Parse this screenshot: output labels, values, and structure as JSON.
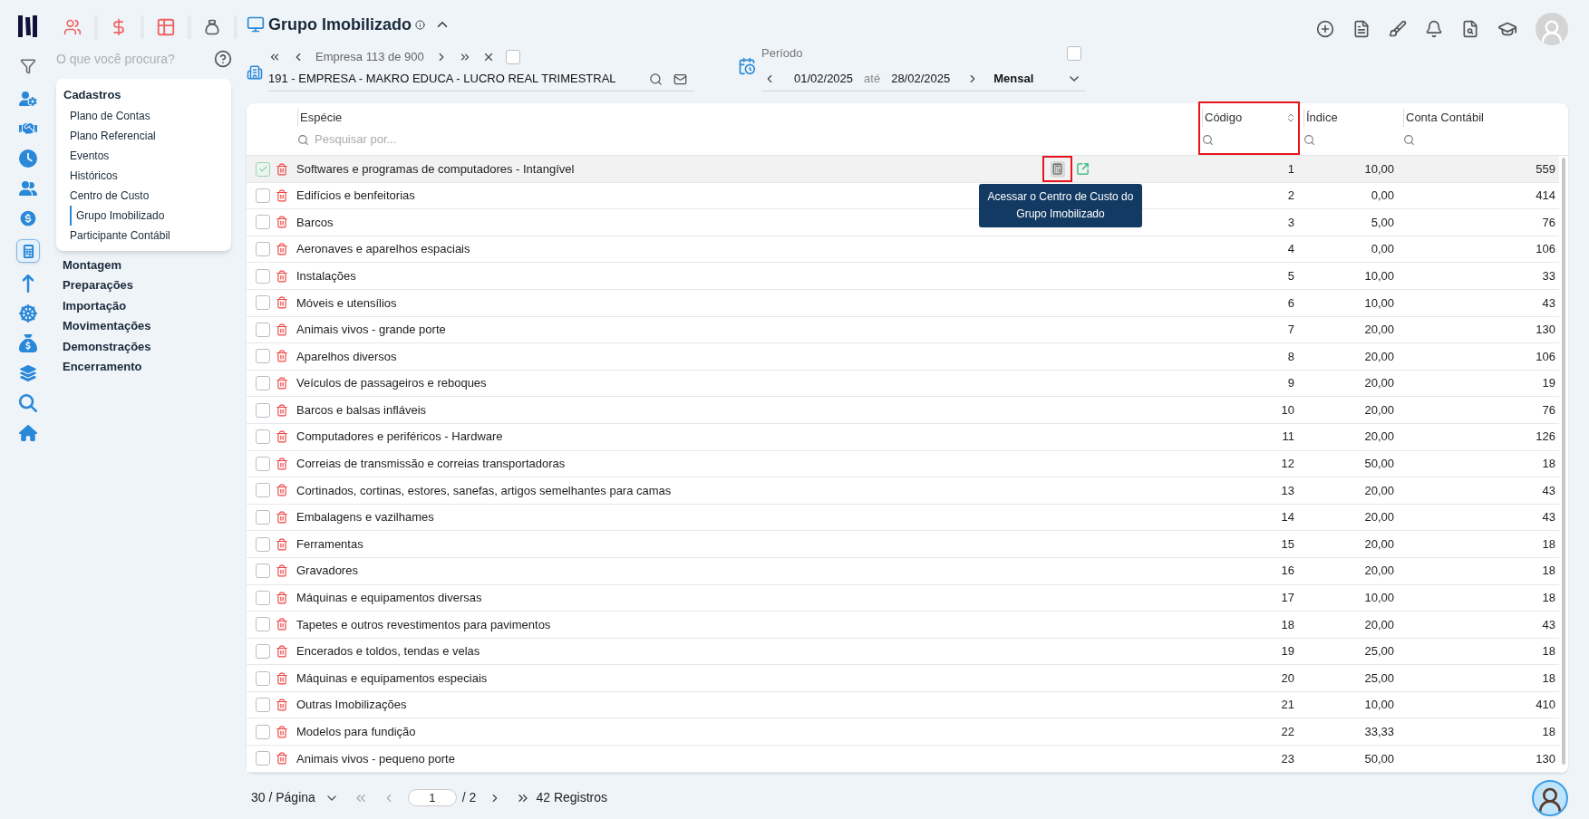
{
  "search": {
    "placeholder": "O que você procura?"
  },
  "menu": [
    {
      "label": "Cadastros",
      "expanded": true,
      "items": [
        {
          "label": "Plano de Contas",
          "selected": false
        },
        {
          "label": "Plano Referencial",
          "selected": false
        },
        {
          "label": "Eventos",
          "selected": false
        },
        {
          "label": "Históricos",
          "selected": false
        },
        {
          "label": "Centro de Custo",
          "selected": false
        },
        {
          "label": "Grupo Imobilizado",
          "selected": true
        },
        {
          "label": "Participante Contábil",
          "selected": false
        }
      ]
    },
    {
      "label": "Montagem",
      "expanded": false
    },
    {
      "label": "Preparações",
      "expanded": false
    },
    {
      "label": "Importação",
      "expanded": false
    },
    {
      "label": "Movimentações",
      "expanded": false
    },
    {
      "label": "Demonstrações",
      "expanded": false
    },
    {
      "label": "Encerramento",
      "expanded": false
    }
  ],
  "page": {
    "title": "Grupo Imobilizado"
  },
  "company_nav": {
    "counter": "Empresa 113 de 900",
    "company": "191 - EMPRESA - MAKRO EDUCA - LUCRO REAL TRIMESTRAL",
    "checked": false
  },
  "period": {
    "label": "Período",
    "start": "01/02/2025",
    "separator": "até",
    "end": "28/02/2025",
    "frequency": "Mensal",
    "checked": false
  },
  "table": {
    "columns": [
      {
        "label": "Espécie",
        "search_placeholder": "Pesquisar por...",
        "sorted": false,
        "highlighted": false
      },
      {
        "label": "Código",
        "sorted": true,
        "highlighted": true
      },
      {
        "label": "Índice",
        "sorted": false,
        "highlighted": false
      },
      {
        "label": "Conta Contábil",
        "sorted": false,
        "highlighted": false
      }
    ],
    "tooltip": "Acessar o Centro de Custo do Grupo Imobilizado",
    "rows": [
      {
        "especie": "Softwares e programas de computadores - Intangível",
        "codigo": "1",
        "indice": "10,00",
        "conta": "559",
        "selected": true,
        "hovered": true
      },
      {
        "especie": "Edifícios e benfeitorias",
        "codigo": "2",
        "indice": "0,00",
        "conta": "414",
        "selected": false,
        "hovered": false
      },
      {
        "especie": "Barcos",
        "codigo": "3",
        "indice": "5,00",
        "conta": "76",
        "selected": false,
        "hovered": false
      },
      {
        "especie": "Aeronaves e aparelhos espaciais",
        "codigo": "4",
        "indice": "0,00",
        "conta": "106",
        "selected": false,
        "hovered": false
      },
      {
        "especie": "Instalações",
        "codigo": "5",
        "indice": "10,00",
        "conta": "33",
        "selected": false,
        "hovered": false
      },
      {
        "especie": "Móveis e utensílios",
        "codigo": "6",
        "indice": "10,00",
        "conta": "43",
        "selected": false,
        "hovered": false
      },
      {
        "especie": "Animais vivos - grande porte",
        "codigo": "7",
        "indice": "20,00",
        "conta": "130",
        "selected": false,
        "hovered": false
      },
      {
        "especie": "Aparelhos diversos",
        "codigo": "8",
        "indice": "20,00",
        "conta": "106",
        "selected": false,
        "hovered": false
      },
      {
        "especie": "Veículos de passageiros e reboques",
        "codigo": "9",
        "indice": "20,00",
        "conta": "19",
        "selected": false,
        "hovered": false
      },
      {
        "especie": "Barcos e balsas infláveis",
        "codigo": "10",
        "indice": "20,00",
        "conta": "76",
        "selected": false,
        "hovered": false
      },
      {
        "especie": "Computadores e periféricos - Hardware",
        "codigo": "11",
        "indice": "20,00",
        "conta": "126",
        "selected": false,
        "hovered": false
      },
      {
        "especie": "Correias de transmissão e correias transportadoras",
        "codigo": "12",
        "indice": "50,00",
        "conta": "18",
        "selected": false,
        "hovered": false
      },
      {
        "especie": "Cortinados, cortinas, estores, sanefas, artigos semelhantes para camas",
        "codigo": "13",
        "indice": "20,00",
        "conta": "43",
        "selected": false,
        "hovered": false
      },
      {
        "especie": "Embalagens e vazilhames",
        "codigo": "14",
        "indice": "20,00",
        "conta": "43",
        "selected": false,
        "hovered": false
      },
      {
        "especie": "Ferramentas",
        "codigo": "15",
        "indice": "20,00",
        "conta": "18",
        "selected": false,
        "hovered": false
      },
      {
        "especie": "Gravadores",
        "codigo": "16",
        "indice": "20,00",
        "conta": "18",
        "selected": false,
        "hovered": false
      },
      {
        "especie": "Máquinas e equipamentos diversas",
        "codigo": "17",
        "indice": "10,00",
        "conta": "18",
        "selected": false,
        "hovered": false
      },
      {
        "especie": "Tapetes e outros revestimentos para pavimentos",
        "codigo": "18",
        "indice": "20,00",
        "conta": "43",
        "selected": false,
        "hovered": false
      },
      {
        "especie": "Encerados e toldos, tendas e velas",
        "codigo": "19",
        "indice": "25,00",
        "conta": "18",
        "selected": false,
        "hovered": false
      },
      {
        "especie": "Máquinas e equipamentos especiais",
        "codigo": "20",
        "indice": "25,00",
        "conta": "18",
        "selected": false,
        "hovered": false
      },
      {
        "especie": "Outras Imobilizações",
        "codigo": "21",
        "indice": "10,00",
        "conta": "410",
        "selected": false,
        "hovered": false
      },
      {
        "especie": "Modelos para fundição",
        "codigo": "22",
        "indice": "33,33",
        "conta": "18",
        "selected": false,
        "hovered": false
      },
      {
        "especie": "Animais vivos - pequeno porte",
        "codigo": "23",
        "indice": "50,00",
        "conta": "130",
        "selected": false,
        "hovered": false
      }
    ]
  },
  "pagination": {
    "page_size": "30 / Página",
    "page": "1",
    "total": "/ 2",
    "records": "42 Registros"
  }
}
